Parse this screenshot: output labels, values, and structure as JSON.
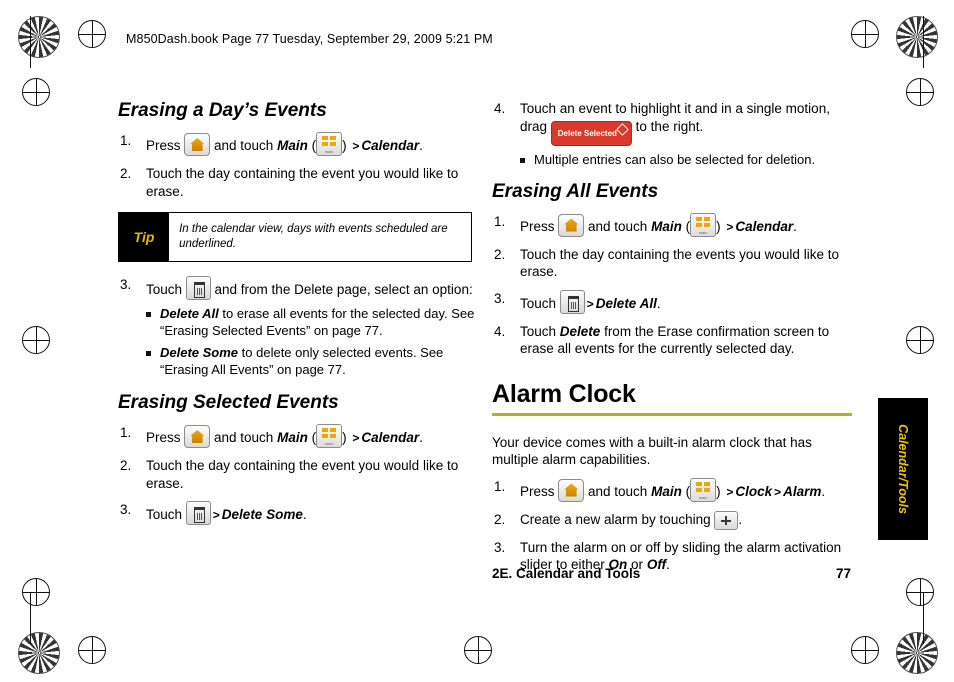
{
  "header": {
    "bookinfo": "M850Dash.book  Page 77  Tuesday, September 29, 2009  5:21 PM"
  },
  "left_column": {
    "section1_title": "Erasing a Day’s Events",
    "steps": [
      {
        "num": "1.",
        "parts": [
          "Press ",
          "[home-key]",
          " and touch ",
          "Main",
          " (",
          "[main-key]",
          ") ",
          ">",
          " ",
          "Calendar",
          "."
        ]
      },
      {
        "num": "2.",
        "text": "Touch the day containing the event you would like to erase."
      }
    ],
    "tip": {
      "label": "Tip",
      "text": "In the calendar view, days with events scheduled are underlined."
    },
    "step3": {
      "num": "3.",
      "pre": "Touch ",
      "post": " and from the Delete page, select an option:"
    },
    "step3_subs": [
      {
        "bold": "Delete All",
        "text": " to erase all events for the selected day. See “Erasing Selected Events” on page 77."
      },
      {
        "bold": "Delete Some",
        "text": " to delete only selected events. See “Erasing All Events” on page 77."
      }
    ],
    "section2_title": "Erasing Selected Events",
    "steps2": [
      {
        "num": "1.",
        "parts": [
          "Press ",
          "[home-key]",
          " and touch ",
          "Main",
          " (",
          "[main-key]",
          ") ",
          ">",
          " ",
          "Calendar",
          "."
        ]
      },
      {
        "num": "2.",
        "text": "Touch the day containing the event you would like to erase."
      },
      {
        "num": "3.",
        "pre": "Touch ",
        "sep": ">",
        "post": "Delete Some",
        "end": "."
      }
    ]
  },
  "right_column": {
    "step4": {
      "num": "4.",
      "pre": "Touch an event to highlight it and in a single motion, drag ",
      "badge": "Delete Selected",
      "post": " to the right."
    },
    "step4_sub": "Multiple entries can also be selected for deletion.",
    "section_title": "Erasing All Events",
    "steps": [
      {
        "num": "1.",
        "parts": [
          "Press ",
          "[home-key]",
          " and touch ",
          "Main",
          " (",
          "[main-key]",
          ") ",
          ">",
          " ",
          "Calendar",
          "."
        ]
      },
      {
        "num": "2.",
        "text": "Touch the day containing the events you would like to erase."
      },
      {
        "num": "3.",
        "pre": "Touch ",
        "sep": ">",
        "post": "Delete All",
        "end": "."
      },
      {
        "num": "4.",
        "pre": "Touch ",
        "bold": "Delete",
        "post": " from the Erase confirmation screen to erase all events for the currently selected day."
      }
    ],
    "chapter_title": "Alarm Clock",
    "chapter_lead": "Your device comes with a built-in alarm clock that has multiple alarm capabilities.",
    "chapter_steps": [
      {
        "num": "1.",
        "parts": [
          "Press ",
          "[home-key]",
          " and touch ",
          "Main",
          " (",
          "[main-key]",
          ") ",
          ">",
          " ",
          "Clock",
          " ",
          ">",
          " ",
          "Alarm",
          "."
        ]
      },
      {
        "num": "2.",
        "pre": "Create a new alarm by touching ",
        "post": "."
      },
      {
        "num": "3.",
        "pre": "Turn the alarm on or off by sliding the alarm activation slider to either ",
        "on": "On",
        "mid": " or ",
        "off": "Off",
        "end": "."
      }
    ]
  },
  "sidetab": {
    "label": "Calendar/Tools"
  },
  "footer": {
    "text": "2E. Calendar and Tools",
    "page": "77"
  },
  "colors": {
    "rule": "#b6b024",
    "tip_label_text": "#e0b900",
    "badge": "#d93a2b",
    "sidetab_text": "#e8c400"
  }
}
